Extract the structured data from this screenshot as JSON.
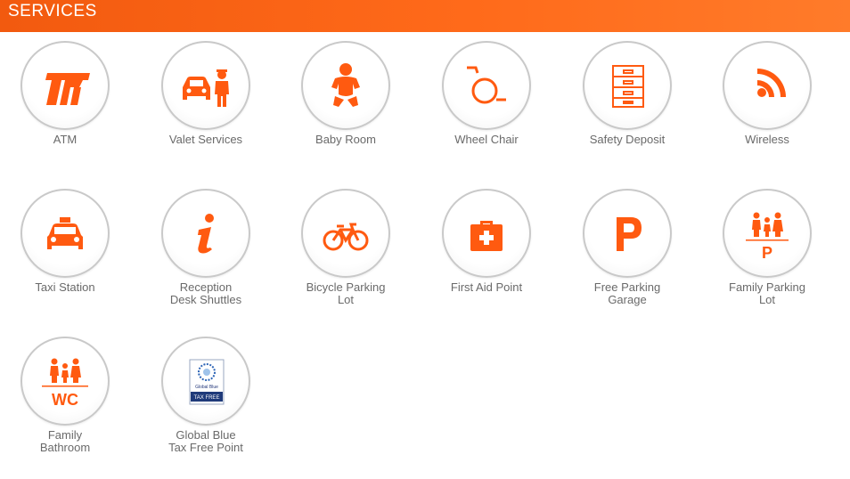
{
  "header": {
    "title": "SERVICES"
  },
  "accent_color": "#ff5a10",
  "services": [
    {
      "label": "ATM",
      "icon": "atm-icon"
    },
    {
      "label": "Valet Services",
      "icon": "valet-icon"
    },
    {
      "label": "Baby Room",
      "icon": "baby-icon"
    },
    {
      "label": "Wheel Chair",
      "icon": "wheelchair-icon"
    },
    {
      "label": "Safety Deposit",
      "icon": "safety-deposit-icon"
    },
    {
      "label": "Wireless",
      "icon": "wireless-icon"
    },
    {
      "label": "Taxi Station",
      "icon": "taxi-icon"
    },
    {
      "label": "Reception\nDesk Shuttles",
      "icon": "info-icon"
    },
    {
      "label": "Bicycle Parking\nLot",
      "icon": "bicycle-icon"
    },
    {
      "label": "First Aid Point",
      "icon": "first-aid-icon"
    },
    {
      "label": "Free Parking\nGarage",
      "icon": "parking-icon"
    },
    {
      "label": "Family Parking\nLot",
      "icon": "family-parking-icon"
    },
    {
      "label": "Family\nBathroom",
      "icon": "family-bathroom-icon"
    },
    {
      "label": "Global Blue\nTax Free Point",
      "icon": "global-blue-icon"
    }
  ],
  "icon_text": {
    "family_parking_letter": "P",
    "family_bathroom_letters": "WC",
    "global_blue_line1": "Global Blue",
    "global_blue_line2": "TAX FREE"
  }
}
